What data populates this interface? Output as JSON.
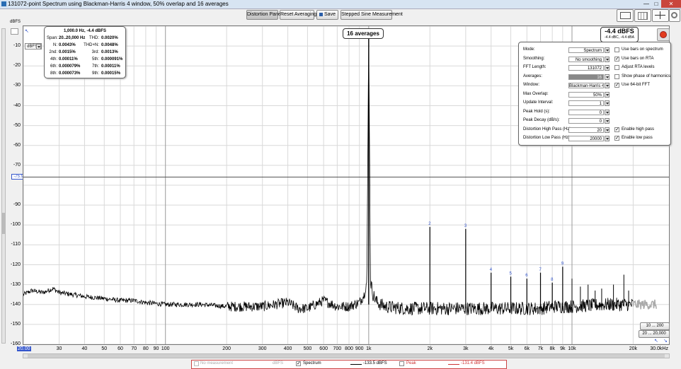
{
  "window": {
    "title": "131072-point Spectrum using Blackman-Harris 4 window, 50% overlap and 16 averages"
  },
  "toolbar": {
    "distortion_panel": "Distortion Panel",
    "reset_averaging": "Reset Averaging",
    "save": "Save",
    "stepped_sine": "Stepped Sine Measurement"
  },
  "axis": {
    "y_unit": "dBFS",
    "y_ticks": [
      "-10",
      "-20",
      "-30",
      "-40",
      "-50",
      "-60",
      "-70",
      "-75.9",
      "-90",
      "-100",
      "-110",
      "-120",
      "-130",
      "-140",
      "-150",
      "-160"
    ],
    "x_ticks": [
      "20.00",
      "30",
      "40",
      "50",
      "60",
      "70",
      "80",
      "90",
      "100",
      "200",
      "300",
      "400",
      "500",
      "600",
      "700",
      "800",
      "900",
      "1k",
      "2k",
      "3k",
      "4k",
      "5k",
      "6k",
      "7k",
      "8k",
      "9k",
      "10k",
      "20k",
      "30.0kHz"
    ],
    "y_selector": "dBFS",
    "cursor_level": "-75.9"
  },
  "distortion": {
    "header": "1,000.0 Hz, -4.4 dBFS",
    "span_label": "Span:",
    "span_value": "20..20,000 Hz",
    "thd_label": "THD:",
    "thd_value": "0.0020%",
    "n_label": "N:",
    "n_value": "0.0043%",
    "thdn_label": "THD+N:",
    "thdn_value": "0.0048%",
    "harmonics": [
      {
        "label": "2nd:",
        "value": "0.0015%"
      },
      {
        "label": "3rd:",
        "value": "0.0013%"
      },
      {
        "label": "4th:",
        "value": "0.00011%"
      },
      {
        "label": "5th:",
        "value": "0.000091%"
      },
      {
        "label": "6th:",
        "value": "0.000079%"
      },
      {
        "label": "7th:",
        "value": "0.00011%"
      },
      {
        "label": "8th:",
        "value": "0.000073%"
      },
      {
        "label": "9th:",
        "value": "0.00015%"
      }
    ]
  },
  "averages_label": "16 averages",
  "level": {
    "main": "-4.4 dBFS",
    "sub": "-4.4 dBC, -4.4 dBA"
  },
  "settings": {
    "rows": [
      {
        "label": "Mode:",
        "value": "Spectrum"
      },
      {
        "label": "Smoothing:",
        "value": "No smoothing"
      },
      {
        "label": "FFT Length:",
        "value": "131072"
      },
      {
        "label": "Averages:",
        "value": "16"
      },
      {
        "label": "Window:",
        "value": "Blackman-Harris 4"
      },
      {
        "label": "Max Overlap:",
        "value": "50%"
      },
      {
        "label": "Update Interval:",
        "value": "1"
      },
      {
        "label": "Peak Hold (s):",
        "value": "0"
      },
      {
        "label": "Peak Decay (dB/s):",
        "value": "0"
      },
      {
        "label": "Distortion High Pass (Hz):",
        "value": "20"
      },
      {
        "label": "Distortion Low Pass (Hz):",
        "value": "20000"
      }
    ],
    "checks": [
      {
        "label": "Use bars on spectrum",
        "checked": false
      },
      {
        "label": "Use bars on RTA",
        "checked": true
      },
      {
        "label": "Adjust RTA levels",
        "checked": false
      },
      {
        "label": "Show phase of harmonics",
        "checked": false
      },
      {
        "label": "Use 64-bit FFT",
        "checked": true
      }
    ],
    "enable_high_pass": "Enable high pass",
    "enable_low_pass": "Enable low pass"
  },
  "range_buttons": {
    "r1": "10 ... 200",
    "r2": "20 ... 20,000"
  },
  "legend": {
    "no_measurement": "No measurement",
    "unit1": "dBFS",
    "spectrum": "Spectrum",
    "spectrum_value": "-133.5 dBFS",
    "peak": "Peak",
    "peak_value": "-131.4 dBFS"
  },
  "colors": {
    "accent_blue": "#3355cc",
    "record_red": "#e23b1d",
    "legend_red": "#cc3333"
  },
  "chart_data": {
    "type": "line",
    "xlabel": "",
    "ylabel": "dBFS",
    "xscale": "log",
    "xlim": [
      20,
      30000
    ],
    "ylim": [
      -160,
      0
    ],
    "grid": true,
    "series": [
      {
        "name": "Spectrum",
        "x": [
          20,
          22,
          25,
          28,
          30,
          35,
          40,
          50,
          60,
          70,
          80,
          100,
          150,
          200,
          300,
          400,
          450,
          500,
          600,
          700,
          800,
          900,
          950,
          980,
          1000,
          1020,
          1050,
          1100,
          1200,
          1500,
          2000,
          3000,
          4000,
          5000,
          6000,
          7000,
          8000,
          10000,
          15000,
          20000,
          22000,
          25000
        ],
        "y": [
          -135,
          -133,
          -134,
          -132,
          -134,
          -135,
          -136,
          -137,
          -138,
          -138,
          -139,
          -140,
          -140,
          -141,
          -141,
          -139,
          -142,
          -142,
          -138,
          -141,
          -141,
          -139,
          -135,
          -128,
          -4.4,
          -128,
          -135,
          -139,
          -141,
          -142,
          -142,
          -142,
          -142,
          -142,
          -142,
          -142,
          -141,
          -141,
          -140,
          -140,
          -141,
          -142
        ]
      }
    ],
    "harmonics": [
      {
        "label": "2",
        "x": 2000,
        "y": -101
      },
      {
        "label": "3",
        "x": 3000,
        "y": -102
      },
      {
        "label": "4",
        "x": 4000,
        "y": -124
      },
      {
        "label": "5",
        "x": 5000,
        "y": -126
      },
      {
        "label": "6",
        "x": 6000,
        "y": -127
      },
      {
        "label": "7",
        "x": 7000,
        "y": -124
      },
      {
        "label": "8",
        "x": 8000,
        "y": -129
      },
      {
        "label": "9",
        "x": 9000,
        "y": -121
      }
    ],
    "other_spurs": [
      {
        "x": 10000,
        "y": -127
      },
      {
        "x": 11000,
        "y": -131
      },
      {
        "x": 12000,
        "y": -130
      },
      {
        "x": 13000,
        "y": -133
      },
      {
        "x": 14000,
        "y": -132
      },
      {
        "x": 16000,
        "y": -130
      },
      {
        "x": 18000,
        "y": -125
      },
      {
        "x": 19000,
        "y": -133
      }
    ]
  }
}
